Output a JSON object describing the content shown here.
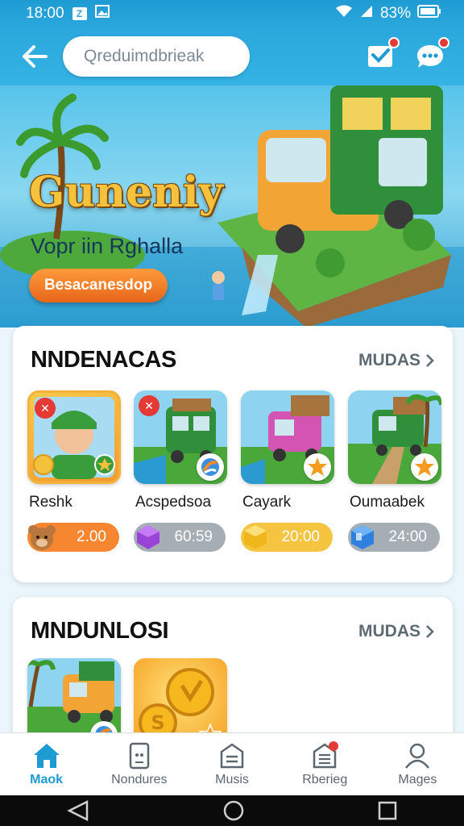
{
  "status_bar": {
    "time": "18:00",
    "battery": "83%"
  },
  "header": {
    "search_placeholder": "Qreduimdbriеak"
  },
  "banner": {
    "title": "Guneniy",
    "subtitle": "Vopr iin Rghalla",
    "button_label": "Besacanesdop"
  },
  "section1": {
    "title": "NNDENACAS",
    "more_label": "MUDAS",
    "apps": [
      {
        "name": "Reshk",
        "price": "2.00",
        "price_color": "#f6862f",
        "icon": "bear-icon"
      },
      {
        "name": "Acspedsoa",
        "price": "60:59",
        "price_color": "#9aa3ab",
        "icon": "purple-gem-icon"
      },
      {
        "name": "Cayark",
        "price": "20:00",
        "price_color": "#f5c542",
        "icon": "yellow-cube-icon"
      },
      {
        "name": "Oumaabek",
        "price": "24:00",
        "price_color": "#9aa3ab",
        "icon": "blue-cube-icon"
      }
    ]
  },
  "section2": {
    "title": "MNDUNLOSI",
    "more_label": "MUDAS"
  },
  "bottom_nav": [
    {
      "label": "Maok",
      "icon": "home-icon",
      "active": true
    },
    {
      "label": "Nondures",
      "icon": "phone-icon",
      "active": false
    },
    {
      "label": "Musis",
      "icon": "document-icon",
      "active": false
    },
    {
      "label": "Rberieg",
      "icon": "list-icon",
      "active": false
    },
    {
      "label": "Mages",
      "icon": "profile-icon",
      "active": false
    }
  ]
}
